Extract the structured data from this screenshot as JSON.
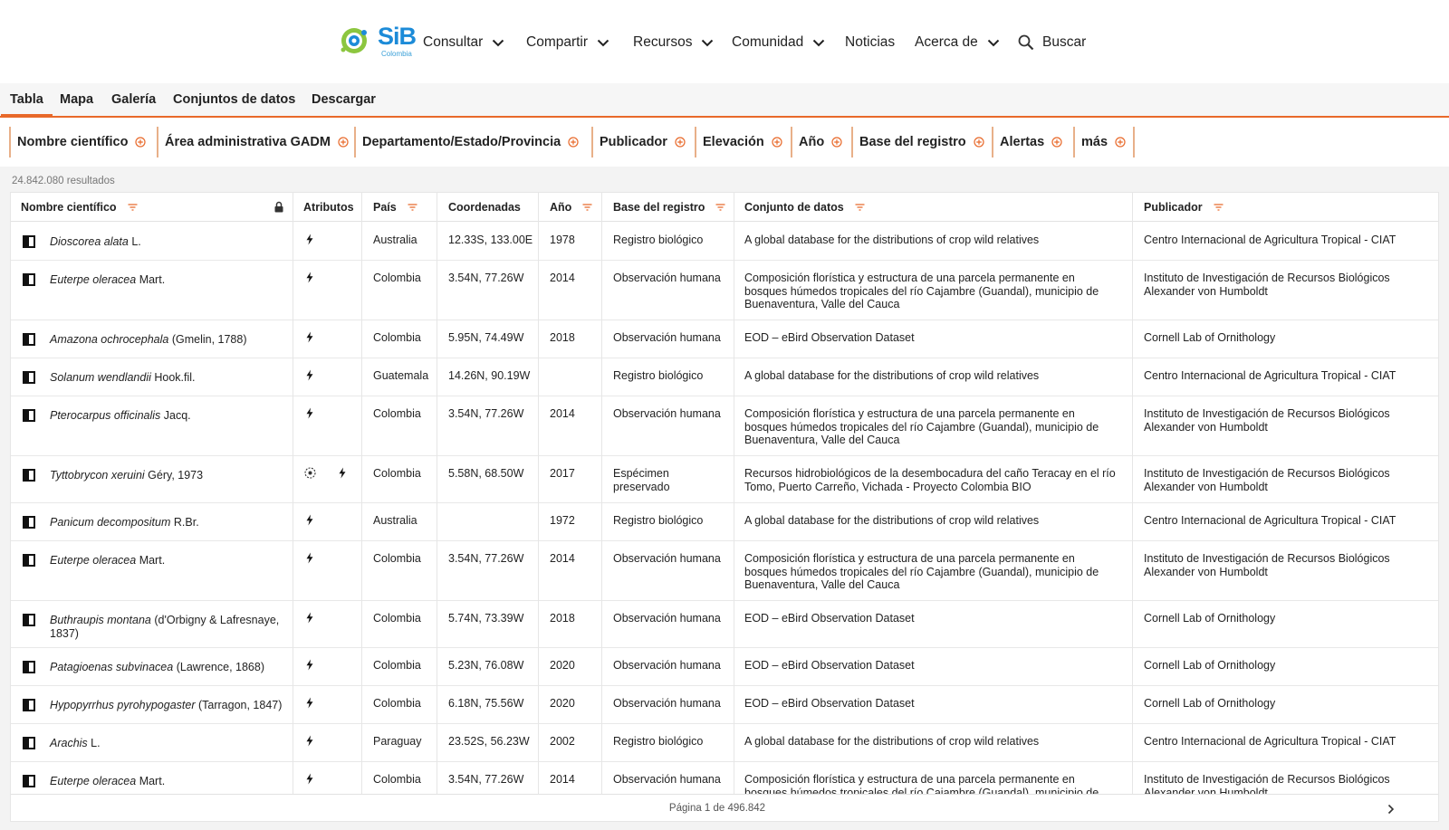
{
  "logo": {
    "text": "SiB",
    "sub": "Colombia",
    "colors": {
      "green": "#8cc63f",
      "blue": "#1c8bd8"
    }
  },
  "nav": {
    "items": [
      {
        "label": "Consultar",
        "dropdown": true
      },
      {
        "label": "Compartir",
        "dropdown": true
      },
      {
        "label": "Recursos",
        "dropdown": true
      },
      {
        "label": "Comunidad",
        "dropdown": true
      },
      {
        "label": "Noticias",
        "dropdown": false
      },
      {
        "label": "Acerca de",
        "dropdown": true
      }
    ],
    "search_label": "Buscar"
  },
  "tabs": [
    "Tabla",
    "Mapa",
    "Galería",
    "Conjuntos de datos",
    "Descargar"
  ],
  "active_tab": "Tabla",
  "filters": [
    "Nombre científico",
    "Área administrativa GADM",
    "Departamento/Estado/Provincia",
    "Publicador",
    "Elevación",
    "Año",
    "Base del registro",
    "Alertas",
    "más"
  ],
  "results_count": "24.842.080 resultados",
  "columns": {
    "scientific_name": "Nombre científico",
    "attributes": "Atributos",
    "country": "País",
    "coordinates": "Coordenadas",
    "year": "Año",
    "basis": "Base del registro",
    "dataset": "Conjunto de datos",
    "publisher": "Publicador"
  },
  "rows": [
    {
      "name": "Dioscorea alata",
      "author": "L.",
      "attrs": [
        "bolt"
      ],
      "country": "Australia",
      "coords": "12.33S, 133.00E",
      "year": "1978",
      "basis": "Registro biológico",
      "dataset": "A global database for the distributions of crop wild relatives",
      "publisher": "Centro Internacional de Agricultura Tropical - CIAT"
    },
    {
      "name": "Euterpe oleracea",
      "author": "Mart.",
      "attrs": [
        "bolt"
      ],
      "country": "Colombia",
      "coords": "3.54N, 77.26W",
      "year": "2014",
      "basis": "Observación humana",
      "dataset": "Composición florística y estructura de una parcela permanente en bosques húmedos tropicales del río Cajambre (Guandal), municipio de Buenaventura, Valle del Cauca",
      "publisher": "Instituto de Investigación de Recursos Biológicos Alexander von Humboldt"
    },
    {
      "name": "Amazona ochrocephala",
      "author": "(Gmelin, 1788)",
      "attrs": [
        "bolt"
      ],
      "country": "Colombia",
      "coords": "5.95N, 74.49W",
      "year": "2018",
      "basis": "Observación humana",
      "dataset": "EOD – eBird Observation Dataset",
      "publisher": "Cornell Lab of Ornithology"
    },
    {
      "name": "Solanum wendlandii",
      "author": "Hook.fil.",
      "attrs": [
        "bolt"
      ],
      "country": "Guatemala",
      "coords": "14.26N, 90.19W",
      "year": "",
      "basis": "Registro biológico",
      "dataset": "A global database for the distributions of crop wild relatives",
      "publisher": "Centro Internacional de Agricultura Tropical - CIAT"
    },
    {
      "name": "Pterocarpus officinalis",
      "author": "Jacq.",
      "attrs": [
        "bolt"
      ],
      "country": "Colombia",
      "coords": "3.54N, 77.26W",
      "year": "2014",
      "basis": "Observación humana",
      "dataset": "Composición florística y estructura de una parcela permanente en bosques húmedos tropicales del río Cajambre (Guandal), municipio de Buenaventura, Valle del Cauca",
      "publisher": "Instituto de Investigación de Recursos Biológicos Alexander von Humboldt"
    },
    {
      "name": "Tyttobrycon xeruini",
      "author": "Géry, 1973",
      "attrs": [
        "globe",
        "bolt"
      ],
      "country": "Colombia",
      "coords": "5.58N, 68.50W",
      "year": "2017",
      "basis": "Espécimen preservado",
      "dataset": "Recursos hidrobiológicos de la desembocadura del caño Teracay en el río Tomo, Puerto Carreño, Vichada - Proyecto Colombia BIO",
      "publisher": "Instituto de Investigación de Recursos Biológicos Alexander von Humboldt"
    },
    {
      "name": "Panicum decompositum",
      "author": "R.Br.",
      "attrs": [
        "bolt"
      ],
      "country": "Australia",
      "coords": "",
      "year": "1972",
      "basis": "Registro biológico",
      "dataset": "A global database for the distributions of crop wild relatives",
      "publisher": "Centro Internacional de Agricultura Tropical - CIAT"
    },
    {
      "name": "Euterpe oleracea",
      "author": "Mart.",
      "attrs": [
        "bolt"
      ],
      "country": "Colombia",
      "coords": "3.54N, 77.26W",
      "year": "2014",
      "basis": "Observación humana",
      "dataset": "Composición florística y estructura de una parcela permanente en bosques húmedos tropicales del río Cajambre (Guandal), municipio de Buenaventura, Valle del Cauca",
      "publisher": "Instituto de Investigación de Recursos Biológicos Alexander von Humboldt"
    },
    {
      "name": "Buthraupis montana",
      "author": "(d'Orbigny & Lafresnaye, 1837)",
      "attrs": [
        "bolt"
      ],
      "country": "Colombia",
      "coords": "5.74N, 73.39W",
      "year": "2018",
      "basis": "Observación humana",
      "dataset": "EOD – eBird Observation Dataset",
      "publisher": "Cornell Lab of Ornithology"
    },
    {
      "name": "Patagioenas subvinacea",
      "author": "(Lawrence, 1868)",
      "attrs": [
        "bolt"
      ],
      "country": "Colombia",
      "coords": "5.23N, 76.08W",
      "year": "2020",
      "basis": "Observación humana",
      "dataset": "EOD – eBird Observation Dataset",
      "publisher": "Cornell Lab of Ornithology"
    },
    {
      "name": "Hypopyrrhus pyrohypogaster",
      "author": "(Tarragon, 1847)",
      "attrs": [
        "bolt"
      ],
      "country": "Colombia",
      "coords": "6.18N, 75.56W",
      "year": "2020",
      "basis": "Observación humana",
      "dataset": "EOD – eBird Observation Dataset",
      "publisher": "Cornell Lab of Ornithology"
    },
    {
      "name": "Arachis",
      "author": "L.",
      "attrs": [
        "bolt"
      ],
      "country": "Paraguay",
      "coords": "23.52S, 56.23W",
      "year": "2002",
      "basis": "Registro biológico",
      "dataset": "A global database for the distributions of crop wild relatives",
      "publisher": "Centro Internacional de Agricultura Tropical - CIAT"
    },
    {
      "name": "Euterpe oleracea",
      "author": "Mart.",
      "attrs": [
        "bolt"
      ],
      "country": "Colombia",
      "coords": "3.54N, 77.26W",
      "year": "2014",
      "basis": "Observación humana",
      "dataset": "Composición florística y estructura de una parcela permanente en bosques húmedos tropicales del río Cajambre (Guandal), municipio de Buenaventura, Valle del Cauca",
      "publisher": "Instituto de Investigación de Recursos Biológicos Alexander von Humboldt"
    }
  ],
  "pager": {
    "text": "Página 1 de 496.842"
  },
  "icons": {
    "nav": "chevron-down-icon",
    "search": "search-icon",
    "filter": "plus-circle-icon",
    "sort": "sort-icon",
    "lock": "lock-icon",
    "attr_bolt": "bolt-icon",
    "attr_globe": "globe-icon",
    "select": "checkbox-icon",
    "next": "chevron-right-icon"
  },
  "colors": {
    "accent": "#e8692a",
    "filter_divider": "#e8b089",
    "tab_bg": "#f6f6f6",
    "results_bg": "#f3f3f3"
  }
}
